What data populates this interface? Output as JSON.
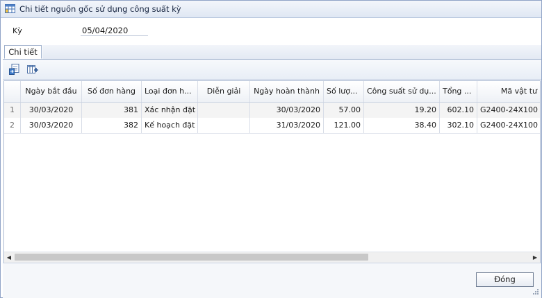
{
  "window": {
    "title": "Chi tiết nguồn gốc sử dụng công suất kỳ",
    "icon": "table-window-icon"
  },
  "filter": {
    "period_label": "Kỳ",
    "period_value": "05/04/2020"
  },
  "tabs": [
    {
      "label": "Chi tiết",
      "active": true
    }
  ],
  "toolbar": {
    "buttons": [
      {
        "icon": "export-icon"
      },
      {
        "icon": "column-chooser-icon"
      }
    ]
  },
  "grid": {
    "columns": [
      "",
      "Ngày bắt đầu",
      "Số đơn hàng",
      "Loại đơn h...",
      "Diễn giải",
      "Ngày hoàn thành",
      "Số lượ...",
      "Công suất sử dụ...",
      "Tổng ...",
      "Mã vật tư"
    ],
    "rows": [
      {
        "no": "1",
        "cells": [
          "30/03/2020",
          "381",
          "Xác nhận đặt",
          "",
          "30/03/2020",
          "57.00",
          "19.20",
          "602.10",
          "G2400-24X100"
        ]
      },
      {
        "no": "2",
        "cells": [
          "30/03/2020",
          "382",
          "Kế hoạch đặt",
          "",
          "31/03/2020",
          "121.00",
          "38.40",
          "302.10",
          "G2400-24X100"
        ]
      }
    ]
  },
  "footer": {
    "close_label": "Đóng"
  },
  "colors": {
    "title_bar": "#dfe7f3",
    "border": "#8fa3c6",
    "row_alt": "#f4f4f4"
  }
}
